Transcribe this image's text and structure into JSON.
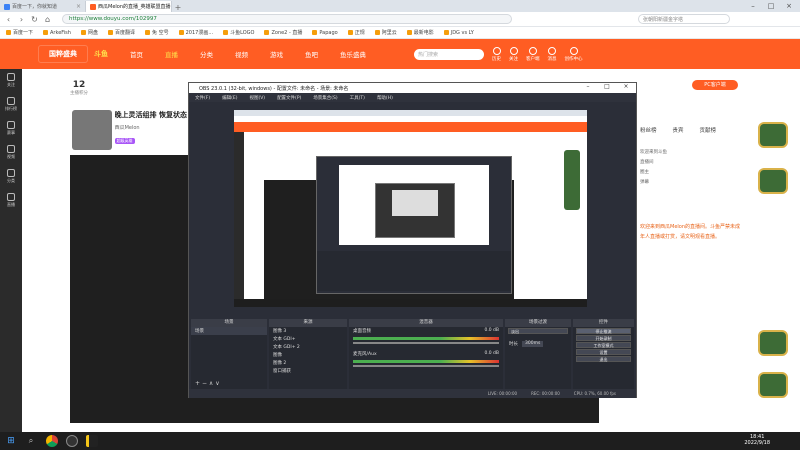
{
  "browser": {
    "tabs": [
      {
        "title": "百度一下，你就知道",
        "active": false
      },
      {
        "title": "西瓜Melon的直播_英雄联盟直播",
        "active": true
      }
    ],
    "url": "https://www.douyu.com/102997",
    "search_placeholder": "张朝阳新疆金字塔",
    "bookmarks": [
      "百度一下",
      "ArkeFish",
      "网盘",
      "百度翻译",
      "免 空号",
      "2017漫画...",
      "斗鱼LOGO",
      "Zone2 - 直播",
      "Papago",
      "正规",
      "阿里云",
      "最新电影",
      "JDG vs LY"
    ]
  },
  "site": {
    "logo": "国粹盛典",
    "brand": "斗鱼",
    "nav": [
      "首页",
      "直播",
      "分类",
      "视频",
      "游戏",
      "鱼吧",
      "鱼乐盛典"
    ],
    "active_nav": "直播",
    "search_placeholder": "热门搜索",
    "header_icons": [
      "历史",
      "关注",
      "客户端",
      "消息",
      "创作中心"
    ],
    "pc_button": "PC客户端"
  },
  "sidebar": [
    "关注",
    "排行榜",
    "赛事",
    "视频",
    "分类",
    "直播"
  ],
  "room": {
    "followers_label": "主播积分",
    "followers_value": "12",
    "title": "晚上灵活组排 恢复状态",
    "streamer": "西瓜Melon",
    "tag": "超级英雄"
  },
  "right_panel": {
    "tabs": [
      "粉丝榜",
      "贵宾",
      "贡献榜"
    ],
    "items": [
      "欢迎来到斗鱼",
      "直播间",
      "圈主",
      "弹幕"
    ],
    "notice": "欢迎来到西瓜Melon的直播间。斗鱼严禁未成年人直播或打赏，请文明观看直播。"
  },
  "obs": {
    "title": "OBS 23.0.1 (32-bit, windows) - 配置文件: 未命名 - 场景: 未命名",
    "menu": [
      "文件(F)",
      "编辑(E)",
      "视图(V)",
      "配置文件(P)",
      "场景集合(S)",
      "工具(T)",
      "帮助(H)"
    ],
    "panels": {
      "scenes": {
        "title": "场景",
        "items": [
          "场景"
        ]
      },
      "sources": {
        "title": "来源",
        "items": [
          "图像 3",
          "文本 GDI+",
          "文本 GDI+ 2",
          "图像",
          "图像 2",
          "窗口捕获"
        ]
      },
      "mixer": {
        "title": "混音器",
        "channels": [
          "桌面音频",
          "麦克风/Aux"
        ],
        "db": "0.0 dB"
      },
      "transitions": {
        "title": "场景过渡",
        "type": "淡出",
        "duration_label": "时长",
        "duration": "300ms"
      },
      "controls": {
        "title": "控件",
        "buttons": [
          "停止推流",
          "开始录制",
          "工作室模式",
          "设置",
          "退出"
        ]
      }
    },
    "status": [
      "LIVE: 00:00:00",
      "REC: 00:00:00",
      "CPU: 0.7%, 60.00 fps"
    ]
  },
  "taskbar": {
    "time": "18:41",
    "date": "2022/9/18"
  }
}
